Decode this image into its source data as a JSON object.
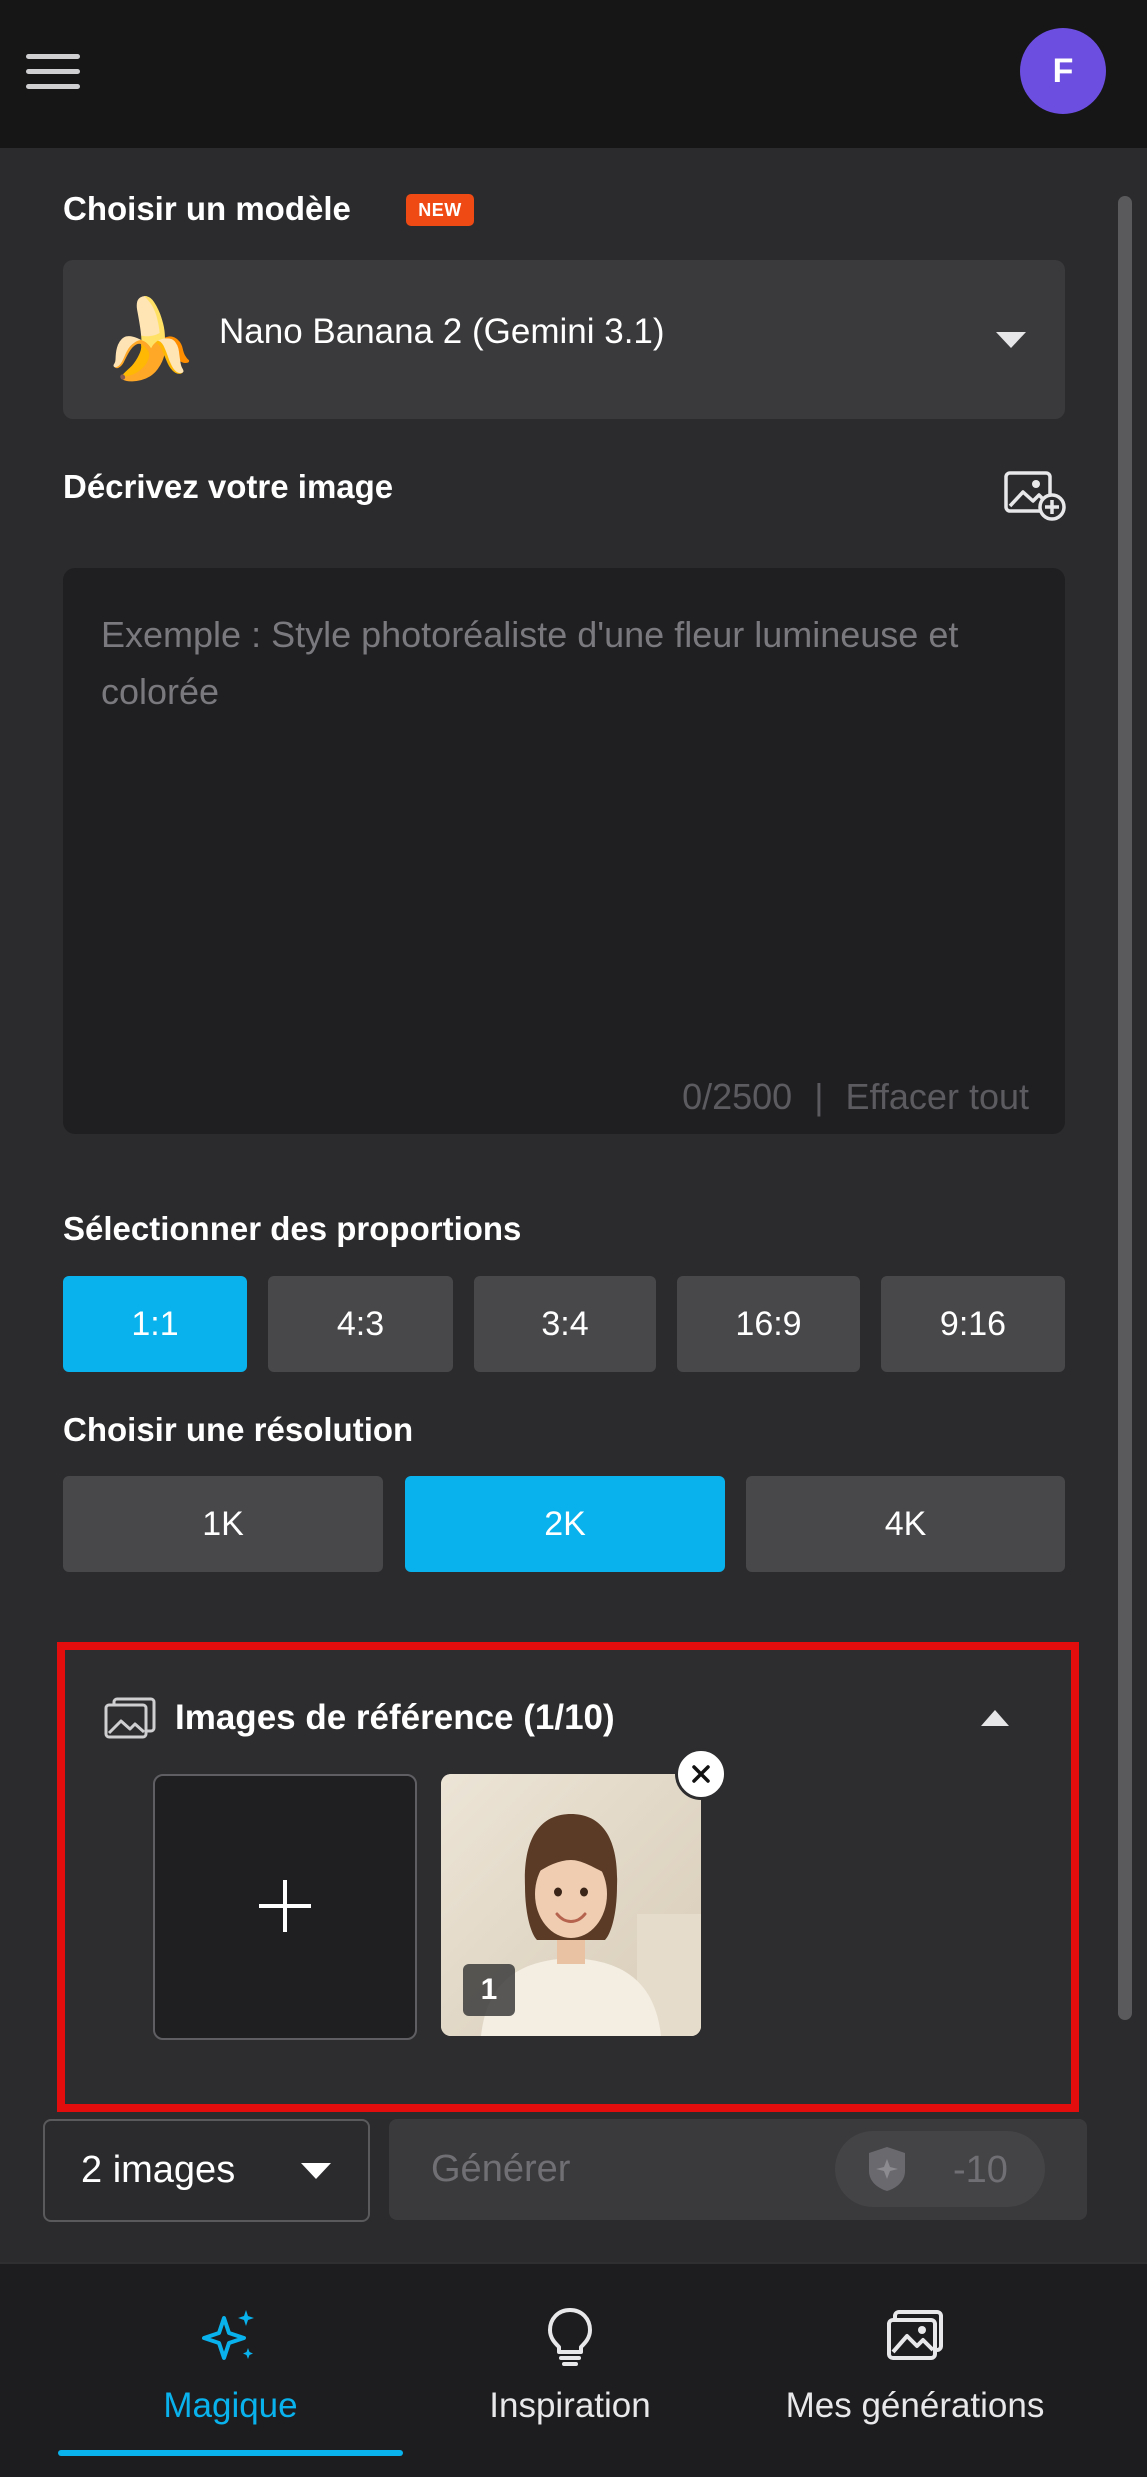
{
  "header": {
    "avatar_initial": "F"
  },
  "model": {
    "section_title": "Choisir un modèle",
    "badge": "NEW",
    "emoji": "🍌",
    "selected": "Nano Banana 2 (Gemini 3.1)"
  },
  "prompt": {
    "section_title": "Décrivez votre image",
    "placeholder": "Exemple : Style photoréaliste d'une fleur lumineuse et colorée",
    "value": "",
    "counter": "0/2500",
    "separator": "|",
    "clear_label": "Effacer tout"
  },
  "proportions": {
    "section_title": "Sélectionner des proportions",
    "options": [
      "1:1",
      "4:3",
      "3:4",
      "16:9",
      "9:16"
    ],
    "selected": "1:1"
  },
  "resolution": {
    "section_title": "Choisir une résolution",
    "options": [
      "1K",
      "2K",
      "4K"
    ],
    "selected": "2K"
  },
  "reference": {
    "title": "Images de référence (1/10)",
    "image_index": "1"
  },
  "actions": {
    "count_label": "2 images",
    "generate_label": "Générer",
    "cost": "-10"
  },
  "nav": {
    "items": [
      {
        "label": "Magique",
        "icon": "sparkle-icon",
        "active": true
      },
      {
        "label": "Inspiration",
        "icon": "lightbulb-icon",
        "active": false
      },
      {
        "label": "Mes générations",
        "icon": "gallery-icon",
        "active": false
      }
    ]
  },
  "colors": {
    "accent": "#09b2ec",
    "badge": "#f04a14",
    "avatar": "#6c4ee0",
    "highlight_border": "#e30d0d"
  }
}
